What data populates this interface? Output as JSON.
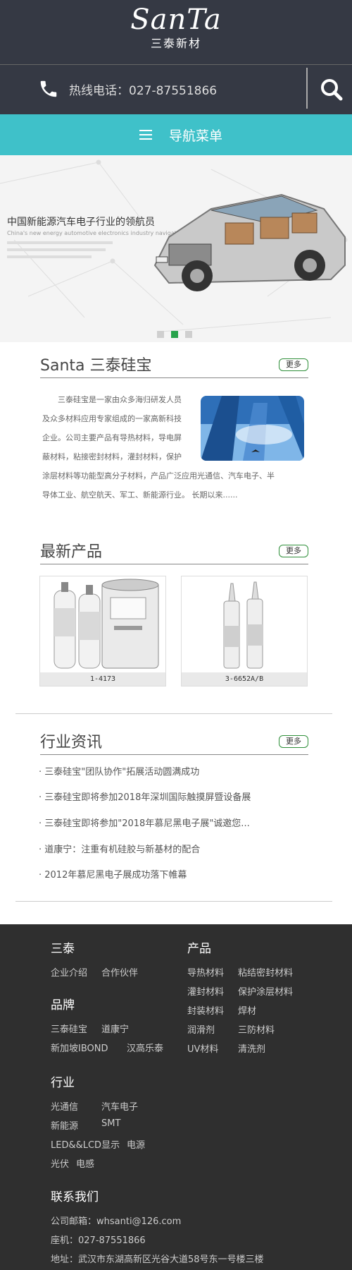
{
  "header": {
    "logo_text": "SanTa",
    "logo_sub": "三泰新材"
  },
  "hotline": {
    "label": "热线电话：027-87551866"
  },
  "nav": {
    "label": "导航菜单"
  },
  "banner": {
    "title": "中国新能源汽车电子行业的领航员",
    "subtitle": "China's new energy automotive electronics industry navigator",
    "slides": 3,
    "active_slide": 2
  },
  "about": {
    "title": "Santa 三泰硅宝",
    "more": "更多",
    "lines": [
      "三泰硅宝是一家由众多海归研发人员",
      "及众多材料应用专家组成的一家高新科技",
      "企业。公司主要产品有导热材料，导电屏",
      "蔽材料，粘接密封材料，灌封材料，保护",
      "涂层材料等功能型高分子材料，产品广泛应用光通信、汽车电子、半",
      "导体工业、航空航天、军工、新能源行业。 长期以来......"
    ]
  },
  "products": {
    "title": "最新产品",
    "more": "更多",
    "items": [
      {
        "caption": "1-4173"
      },
      {
        "caption": "3-6652A/B"
      }
    ]
  },
  "news": {
    "title": "行业资讯",
    "more": "更多",
    "items": [
      "· 三泰硅宝\"团队协作\"拓展活动圆满成功",
      "· 三泰硅宝即将参加2018年深圳国际触摸屏暨设备展",
      "· 三泰硅宝即将参加\"2018年慕尼黑电子展\"诚邀您...",
      "· 道康宁：注重有机硅胶与新基材的配合",
      "· 2012年慕尼黑电子展成功落下帷幕"
    ]
  },
  "footer": {
    "col1_title": "三泰",
    "col1_links": [
      "企业介绍",
      "合作伙伴"
    ],
    "brand_title": "品牌",
    "brand_links": [
      "三泰硅宝",
      "道康宁",
      "新加坡IBOND",
      "汉高乐泰"
    ],
    "product_title": "产品",
    "product_links": [
      "导热材料",
      "粘结密封材料",
      "灌封材料",
      "保护涂层材料",
      "封装材料",
      "焊材",
      "润滑剂",
      "三防材料",
      "UV材料",
      "清洗剂"
    ],
    "industry_title": "行业",
    "industry_links": [
      "光通信",
      "汽车电子",
      "新能源",
      "SMT",
      "LED&&LCD显示",
      "电源",
      "光伏",
      "电感"
    ],
    "contact_title": "联系我们",
    "email": "公司邮箱：whsanti@126.com",
    "phone": "座机：027-87551866",
    "address": "地址：武汉市东湖高新区光谷大道58号东一号楼三楼"
  },
  "colors": {
    "header_bg": "#353944",
    "nav_bg": "#3fc1c9",
    "accent_green": "#27a34b",
    "footer_bg": "#2f2f2f"
  }
}
